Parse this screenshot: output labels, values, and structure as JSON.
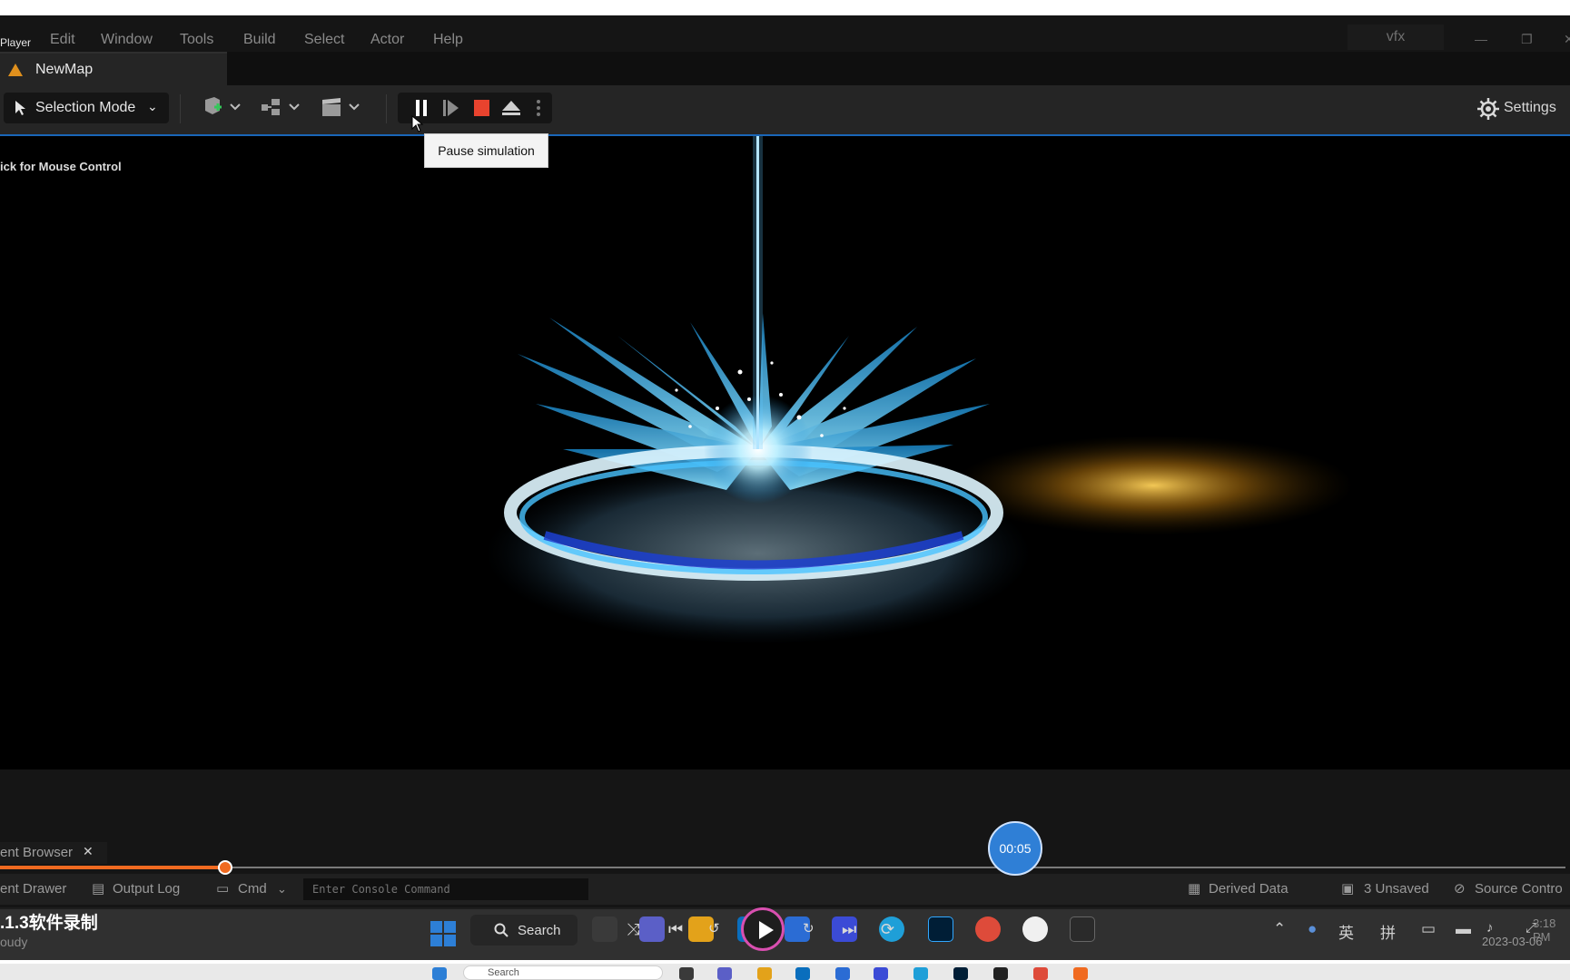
{
  "menubar": {
    "app_name": "Player",
    "items": [
      "Edit",
      "Window",
      "Tools",
      "Build",
      "Select",
      "Actor",
      "Help"
    ],
    "window_title": "vfx"
  },
  "tab": {
    "label": "NewMap"
  },
  "toolbar": {
    "mode_label": "Selection Mode",
    "settings_label": "Settings"
  },
  "tooltip": {
    "text": "Pause simulation"
  },
  "viewport": {
    "mouse_hint": "ick for Mouse Control"
  },
  "content_browser_tab": {
    "label": "ent Browser",
    "close": "✕"
  },
  "statusbar": {
    "content_drawer": "ent Drawer",
    "output_log": "Output Log",
    "cmd": "Cmd",
    "console_placeholder": "Enter Console Command",
    "derived_data": "Derived Data",
    "unsaved": "3 Unsaved",
    "source_control": "Source Contro"
  },
  "player": {
    "time": "00:05",
    "progress_fraction": 0.144,
    "title": ".1.3软件录制",
    "subtitle": "oudy"
  },
  "taskbar": {
    "search_label": "Search",
    "ime_1": "英",
    "ime_2": "拼",
    "clock_time": "3:18 PM",
    "clock_date": "2023-03-06",
    "strip_search": "Search"
  },
  "colors": {
    "accent_blue": "#1a66b8",
    "stop_red": "#e8432e",
    "unreal_orange": "#e0901d",
    "progress_orange": "#f06a20",
    "vfx_cyan": "#37b8f0"
  }
}
